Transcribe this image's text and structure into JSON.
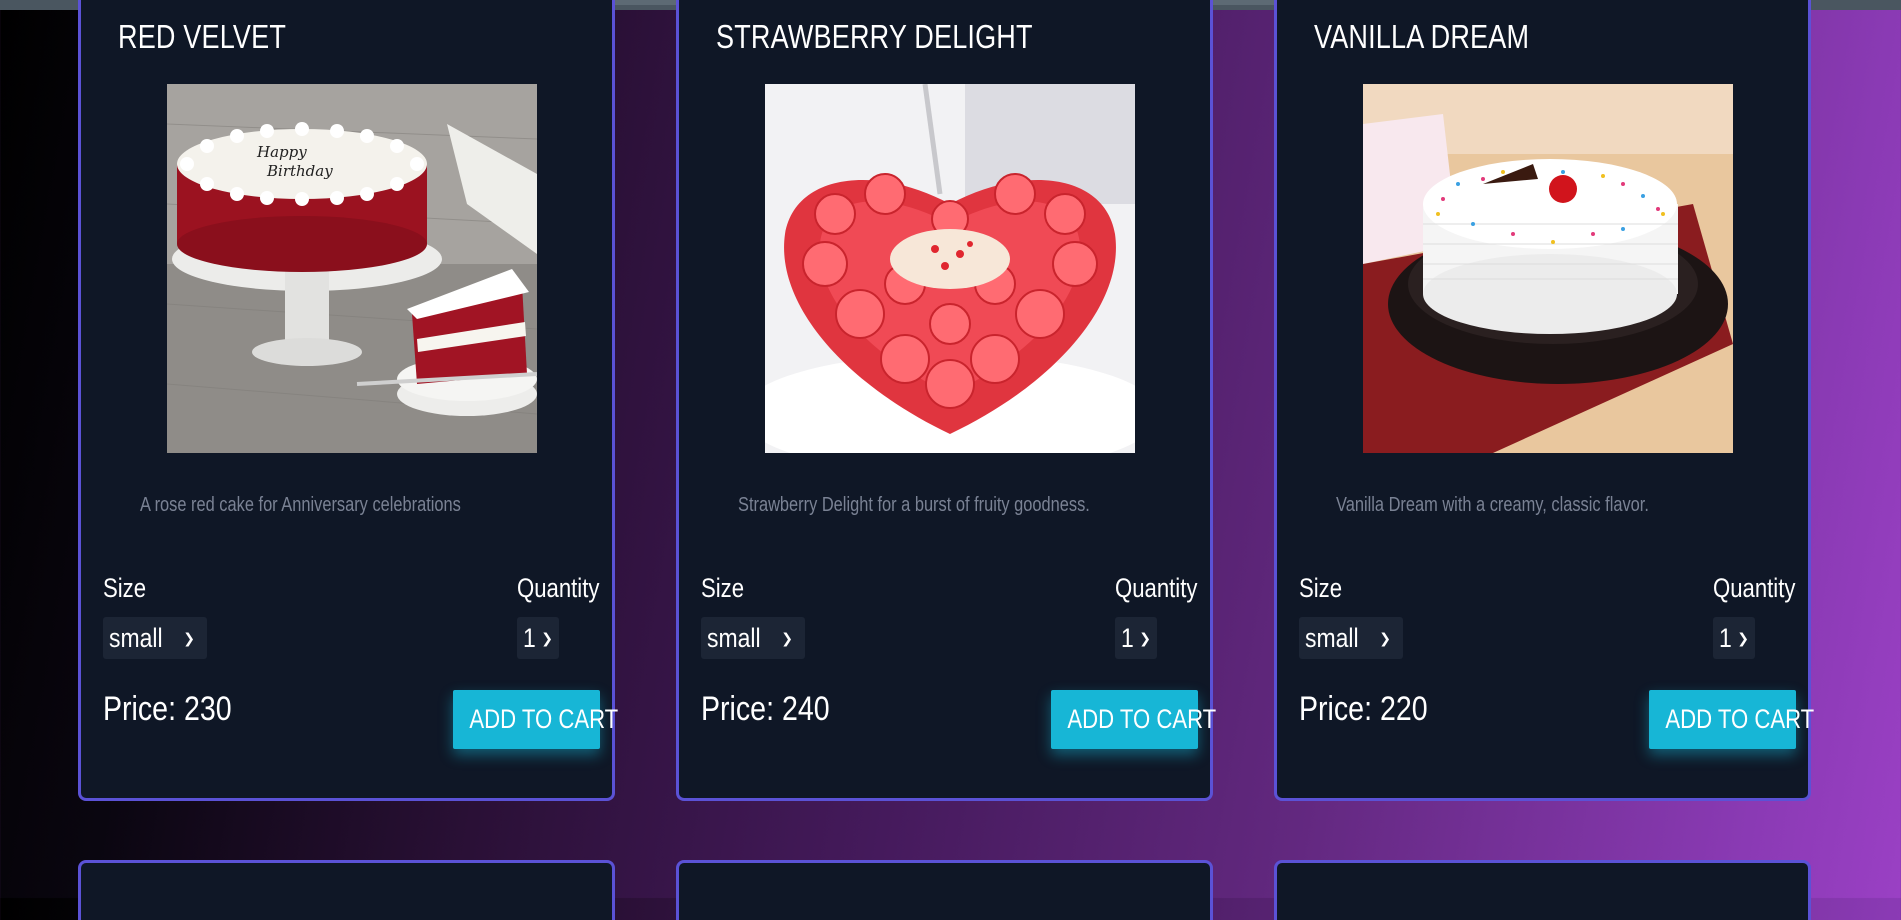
{
  "products": [
    {
      "title": "RED VELVET",
      "image_name": "red-velvet-cake-photo",
      "description": "A rose red cake for Anniversary celebrations",
      "size_label": "Size",
      "size_value": "small",
      "quantity_label": "Quantity",
      "quantity_value": "1",
      "price": "Price: 230",
      "button_label": "ADD TO CART",
      "cake_text": [
        "Happy",
        "Birthday"
      ]
    },
    {
      "title": "STRAWBERRY DELIGHT",
      "image_name": "strawberry-heart-cake-photo",
      "description": "Strawberry Delight for a burst of fruity goodness.",
      "size_label": "Size",
      "size_value": "small",
      "quantity_label": "Quantity",
      "quantity_value": "1",
      "price": "Price: 240",
      "button_label": "ADD TO CART"
    },
    {
      "title": "VANILLA DREAM",
      "image_name": "vanilla-sprinkle-cake-photo",
      "description": "Vanilla Dream with a creamy, classic flavor.",
      "size_label": "Size",
      "size_value": "small",
      "quantity_label": "Quantity",
      "quantity_value": "1",
      "price": "Price: 220",
      "button_label": "ADD TO CART"
    }
  ],
  "colors": {
    "card_bg": "#0f1726",
    "card_border": "#5b52d6",
    "button": "#17b6d6",
    "description": "#7a8294"
  },
  "icons": {
    "select_arrow": "chevron-down-icon"
  }
}
